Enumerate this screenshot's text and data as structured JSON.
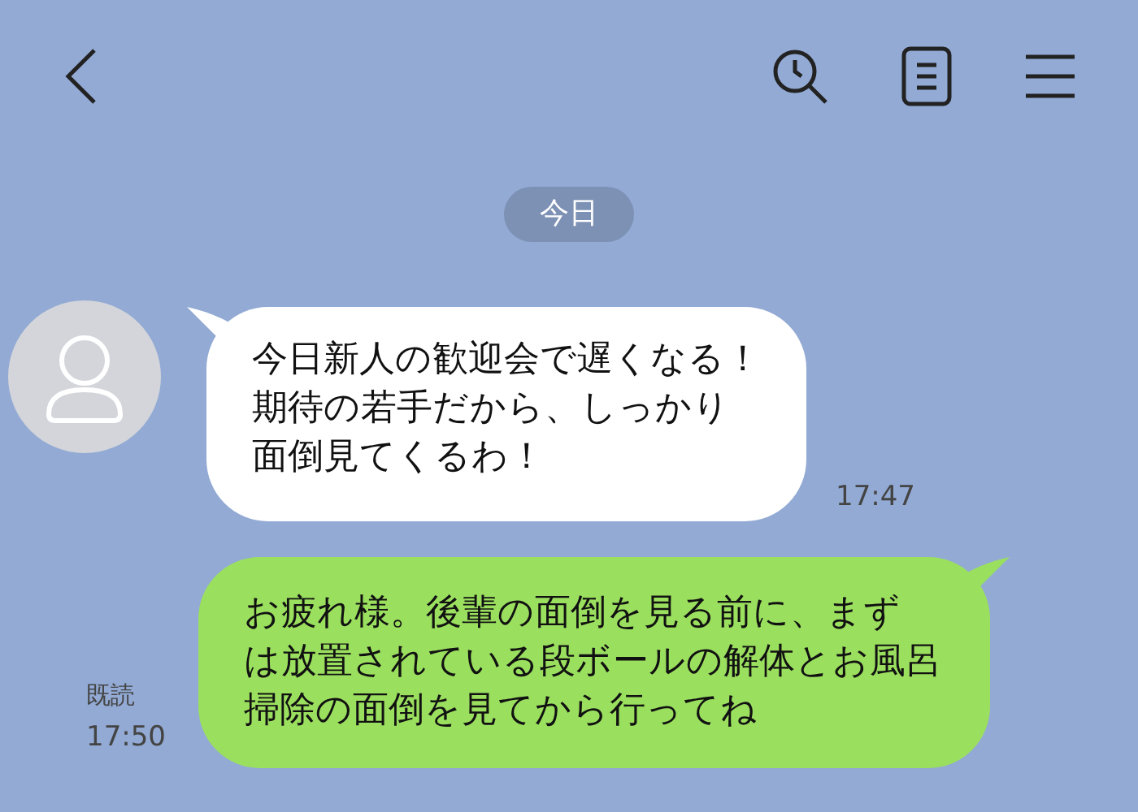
{
  "date_divider": "今日",
  "messages": [
    {
      "kind": "received",
      "lines": [
        "今日新人の歓迎会で遅くなる！",
        "期待の若手だから、しっかり",
        "面倒見てくるわ！"
      ],
      "time": "17:47"
    },
    {
      "kind": "sent",
      "lines": [
        "お疲れ様。後輩の面倒を見る前に、まず",
        "は放置されている段ボールの解体とお風呂",
        "掃除の面倒を見てから行ってね"
      ],
      "read": "既読",
      "time": "17:50"
    }
  ]
}
